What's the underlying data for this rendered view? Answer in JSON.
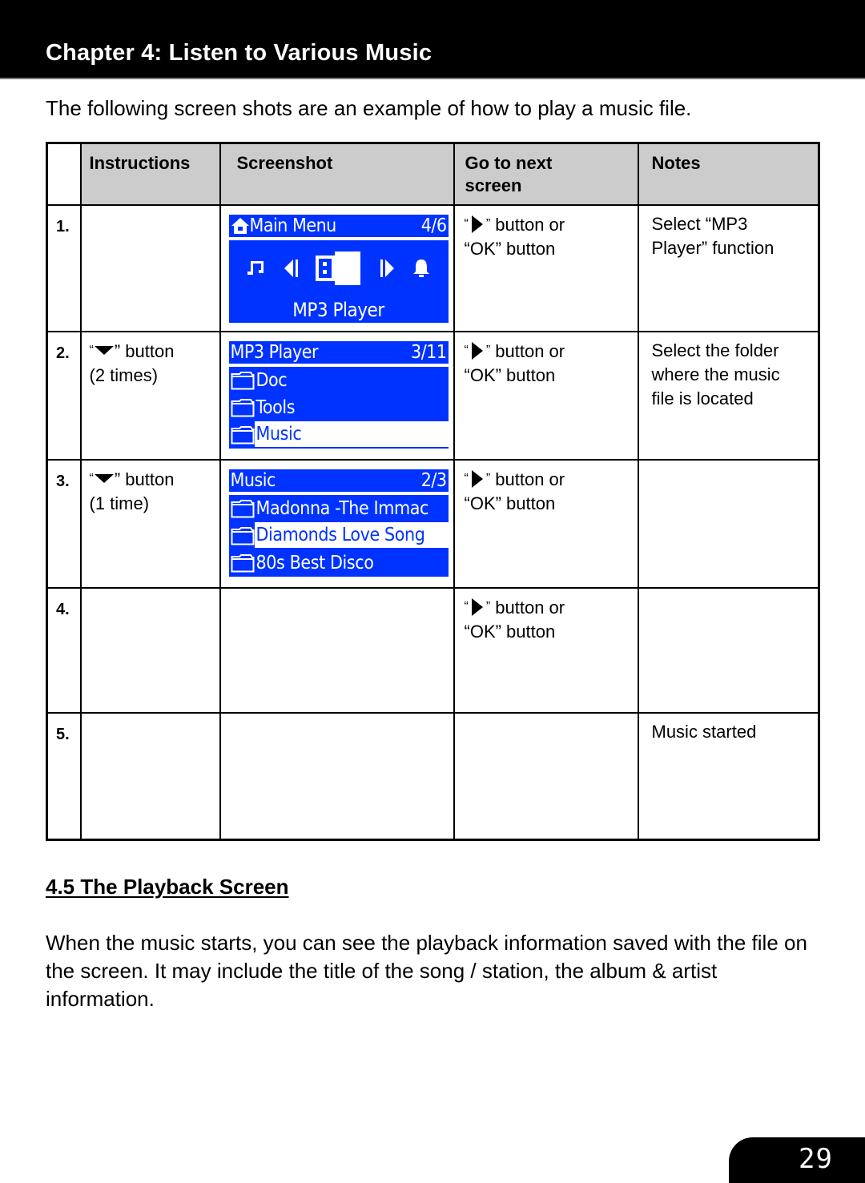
{
  "header": {
    "chapter_title": "Chapter 4: Listen to Various Music"
  },
  "intro": "The following screen shots are an example of how to play a music file.",
  "table": {
    "columns": [
      "",
      "Instructions",
      "Screenshot",
      "Go to next screen",
      "Notes"
    ],
    "rows": [
      {
        "num": "1.",
        "instruction": {
          "prefix": "",
          "glyph": "",
          "text": "",
          "line2": ""
        },
        "screenshot": {
          "type": "main-menu",
          "title": "Main Menu",
          "counter": "4/6",
          "title_icon": "home-icon",
          "icons": [
            "music-note-icon",
            "prev-arrow-icon",
            "usb-drive-icon",
            "next-arrow-icon",
            "alarm-bell-icon"
          ],
          "function_label": "MP3 Player"
        },
        "next": {
          "glyph": "right-triangle-icon",
          "text_after": " button or",
          "line2": "“OK” button"
        },
        "notes": [
          "Select “MP3",
          "Player” function"
        ]
      },
      {
        "num": "2.",
        "instruction": {
          "glyph": "down-triangle-icon",
          "text": "” button",
          "line2": "(2 times)"
        },
        "screenshot": {
          "type": "folder-list",
          "title": "MP3 Player",
          "counter": "3/11",
          "items": [
            {
              "label": "Doc",
              "selected": false
            },
            {
              "label": "Tools",
              "selected": false
            },
            {
              "label": "Music",
              "selected": true
            }
          ]
        },
        "next": {
          "glyph": "right-triangle-icon",
          "text_after": " button or",
          "line2": "“OK” button"
        },
        "notes": [
          "Select the folder",
          "where the music",
          "file is located"
        ]
      },
      {
        "num": "3.",
        "instruction": {
          "glyph": "down-triangle-icon",
          "text": "” button",
          "line2": "(1 time)"
        },
        "screenshot": {
          "type": "folder-list",
          "title": "Music",
          "counter": "2/3",
          "items": [
            {
              "label": "Madonna -The Immac",
              "selected": false
            },
            {
              "label": "Diamonds Love Song",
              "selected": true
            },
            {
              "label": "80s Best Disco",
              "selected": false
            }
          ]
        },
        "next": {
          "glyph": "right-triangle-icon",
          "text_after": " button or",
          "line2": "“OK” button"
        },
        "notes": []
      },
      {
        "num": "4.",
        "next": {
          "glyph": "right-triangle-icon",
          "text_after": " button or",
          "line2": "“OK” button"
        },
        "notes": []
      },
      {
        "num": "5.",
        "notes": [
          "Music started"
        ]
      }
    ]
  },
  "quote_open": "“",
  "quote_close": "”",
  "section": {
    "heading": "4.5 The Playback Screen",
    "body": "When the music starts, you can see the playback information saved with the file on the screen. It may include the title of the song / station, the album & artist information."
  },
  "page_number": "29",
  "colors": {
    "lcd_blue": "#0033ff",
    "header_gray": "#cccccc"
  }
}
